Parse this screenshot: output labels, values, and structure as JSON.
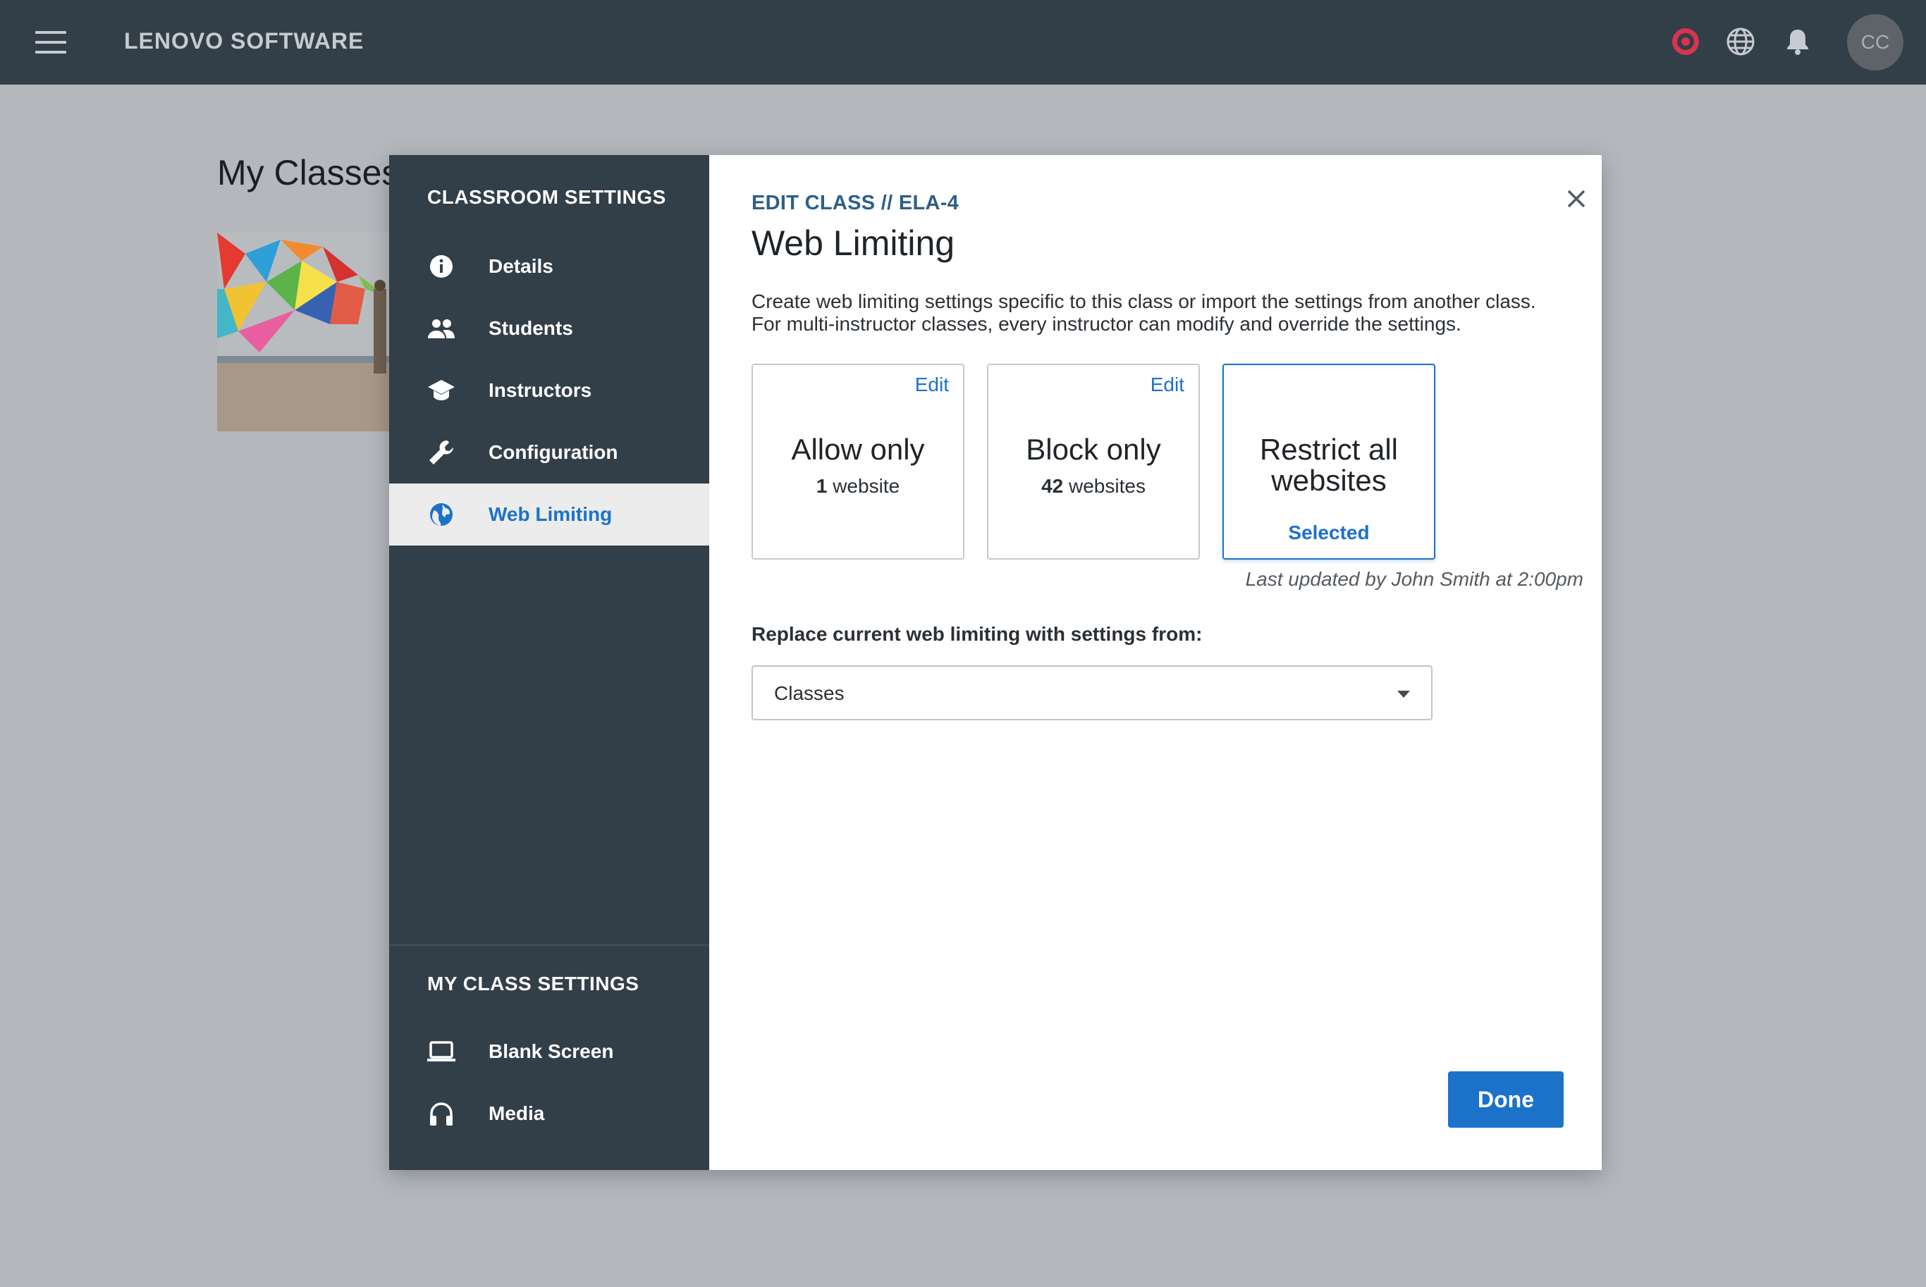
{
  "topbar": {
    "brand": "LENOVO SOFTWARE",
    "avatar_initials": "CC",
    "icons": [
      "menu-icon",
      "record-icon",
      "globe-icon",
      "bell-icon"
    ],
    "record_color": "#d8344f"
  },
  "page": {
    "title": "My Classes"
  },
  "sidebar": {
    "heading": "CLASSROOM SETTINGS",
    "items": [
      {
        "label": "Details",
        "icon": "info-icon"
      },
      {
        "label": "Students",
        "icon": "people-icon"
      },
      {
        "label": "Instructors",
        "icon": "graduation-cap-icon"
      },
      {
        "label": "Configuration",
        "icon": "wrench-icon"
      },
      {
        "label": "Web Limiting",
        "icon": "globe-icon",
        "active": true
      }
    ],
    "my_heading": "MY CLASS SETTINGS",
    "my_items": [
      {
        "label": "Blank Screen",
        "icon": "laptop-icon"
      },
      {
        "label": "Media",
        "icon": "headphones-icon"
      }
    ]
  },
  "main": {
    "breadcrumb": "EDIT CLASS // ELA-4",
    "title": "Web Limiting",
    "description": "Create web limiting settings specific to this class or import the settings from another class. For multi-instructor classes, every instructor can modify and override the settings.",
    "cards": [
      {
        "title": "Allow only",
        "count": "1",
        "unit": "website",
        "edit": "Edit"
      },
      {
        "title": "Block only",
        "count": "42",
        "unit": "websites",
        "edit": "Edit"
      },
      {
        "title": "Restrict all websites",
        "status": "Selected",
        "selected": true
      }
    ],
    "last_updated": "Last updated by John Smith at 2:00pm",
    "replace_label": "Replace current web limiting with settings from:",
    "select_value": "Classes",
    "done_label": "Done"
  },
  "colors": {
    "topbar": "#323e48",
    "sidebar": "#323e48",
    "accent": "#1c72c9",
    "backdrop": "#b4b8bd"
  }
}
